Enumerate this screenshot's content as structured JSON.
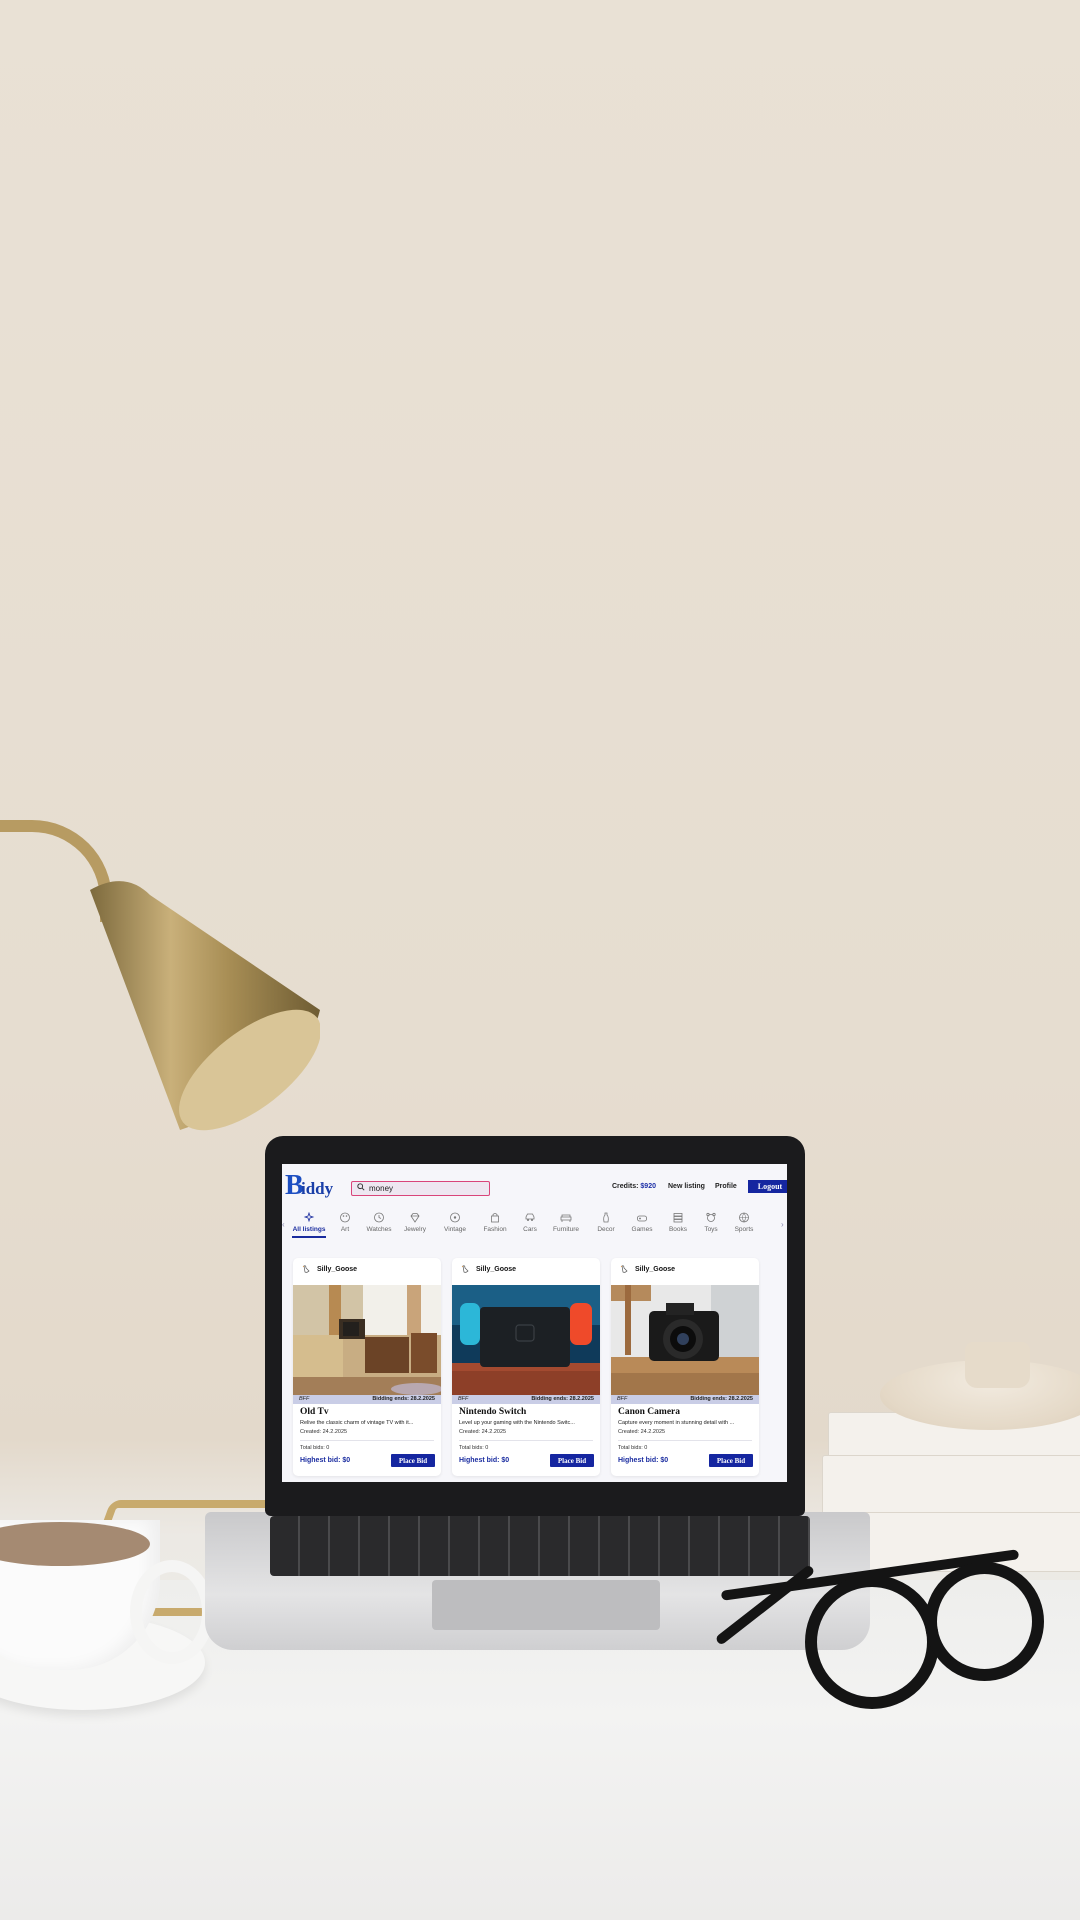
{
  "app": {
    "logo_initial": "B",
    "logo_rest": "iddy"
  },
  "search": {
    "value": "money"
  },
  "nav": {
    "credits_label": "Credits:",
    "credits_value": "$920",
    "new_listing": "New listing",
    "profile": "Profile",
    "logout": "Logout"
  },
  "categories": [
    {
      "label": "All listings",
      "icon": "sparkles-icon",
      "active": true
    },
    {
      "label": "Art",
      "icon": "palette-icon"
    },
    {
      "label": "Watches",
      "icon": "clock-icon"
    },
    {
      "label": "Jewelry",
      "icon": "diamond-icon"
    },
    {
      "label": "Vintage",
      "icon": "vinyl-icon"
    },
    {
      "label": "Fashion",
      "icon": "bag-icon"
    },
    {
      "label": "Cars",
      "icon": "car-icon"
    },
    {
      "label": "Furniture",
      "icon": "sofa-icon"
    },
    {
      "label": "Decor",
      "icon": "vase-icon"
    },
    {
      "label": "Games",
      "icon": "gamepad-icon"
    },
    {
      "label": "Books",
      "icon": "books-icon"
    },
    {
      "label": "Toys",
      "icon": "teddy-icon"
    },
    {
      "label": "Sports",
      "icon": "ball-icon"
    }
  ],
  "listings": [
    {
      "seller": "Silly_Goose",
      "tag": "BFF",
      "ends": "Bidding ends: 28.2.2025",
      "title": "Old Tv",
      "description": "Relive the classic charm of vintage TV with it...",
      "created": "Created: 24.2.2025",
      "total_bids": "Total bids: 0",
      "highest_bid": "Highest bid: $0",
      "button": "Place Bid"
    },
    {
      "seller": "Silly_Goose",
      "tag": "BFF",
      "ends": "Bidding ends: 28.2.2025",
      "title": "Nintendo Switch",
      "description": "Level up your gaming with the Nintendo Switc...",
      "created": "Created: 24.2.2025",
      "total_bids": "Total bids: 0",
      "highest_bid": "Highest bid: $0",
      "button": "Place Bid"
    },
    {
      "seller": "Silly_Goose",
      "tag": "BFF",
      "ends": "Bidding ends: 28.2.2025",
      "title": "Canon Camera",
      "description": "Capture every moment in stunning detail with ...",
      "created": "Created: 24.2.2025",
      "total_bids": "Total bids: 0",
      "highest_bid": "Highest bid: $0",
      "button": "Place Bid"
    }
  ],
  "colors": {
    "accent": "#1526a0",
    "search_border": "#d9457a",
    "wall": "#e8e0d3"
  }
}
